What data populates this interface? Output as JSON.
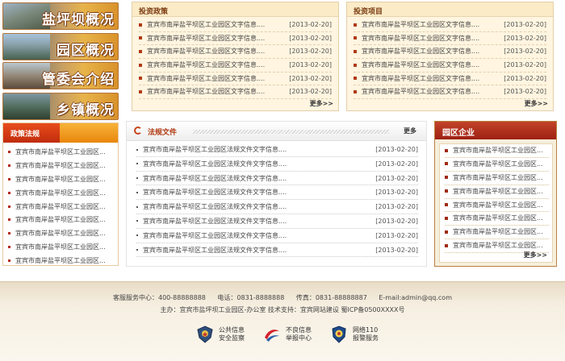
{
  "left_nav": [
    {
      "title": "盐坪坝概况"
    },
    {
      "title": "园区概况"
    },
    {
      "title": "管委会介绍"
    },
    {
      "title": "乡镇概况"
    }
  ],
  "policy_section": {
    "title": "政策法规",
    "items": [
      "宜宾市南岸盐平坝区工业园区...",
      "宜宾市南岸盐平坝区工业园区...",
      "宜宾市南岸盐平坝区工业园区...",
      "宜宾市南岸盐平坝区工业园区...",
      "宜宾市南岸盐平坝区工业园区...",
      "宜宾市南岸盐平坝区工业园区...",
      "宜宾市南岸盐平坝区工业园区...",
      "宜宾市南岸盐平坝区工业园区...",
      "宜宾市南岸盐平坝区工业园区..."
    ]
  },
  "investment_policy": {
    "title": "投资政策",
    "more": "更多>>",
    "items": [
      {
        "title": "宜宾市南岸盐平坝区工业园区文字信息....",
        "date": "[2013-02-20]"
      },
      {
        "title": "宜宾市南岸盐平坝区工业园区文字信息....",
        "date": "[2013-02-20]"
      },
      {
        "title": "宜宾市南岸盐平坝区工业园区文字信息....",
        "date": "[2013-02-20]"
      },
      {
        "title": "宜宾市南岸盐平坝区工业园区文字信息....",
        "date": "[2013-02-20]"
      },
      {
        "title": "宜宾市南岸盐平坝区工业园区文字信息....",
        "date": "[2013-02-20]"
      },
      {
        "title": "宜宾市南岸盐平坝区工业园区文字信息....",
        "date": "[2013-02-20]"
      }
    ]
  },
  "investment_projects": {
    "title": "投资项目",
    "more": "更多>>",
    "items": [
      {
        "title": "宜宾市南岸盐平坝区工业园区文字信息....",
        "date": "[2013-02-20]"
      },
      {
        "title": "宜宾市南岸盐平坝区工业园区文字信息....",
        "date": "[2013-02-20]"
      },
      {
        "title": "宜宾市南岸盐平坝区工业园区文字信息....",
        "date": "[2013-02-20]"
      },
      {
        "title": "宜宾市南岸盐平坝区工业园区文字信息....",
        "date": "[2013-02-20]"
      },
      {
        "title": "宜宾市南岸盐平坝区工业园区文字信息....",
        "date": "[2013-02-20]"
      },
      {
        "title": "宜宾市南岸盐平坝区工业园区文字信息....",
        "date": "[2013-02-20]"
      }
    ]
  },
  "law_documents": {
    "title": "法规文件",
    "more": "更多",
    "items": [
      {
        "title": "宜宾市南岸盐平坝区工业园区法规文件文字信息....",
        "date": "[2013-02-20]"
      },
      {
        "title": "宜宾市南岸盐平坝区工业园区法规文件文字信息....",
        "date": "[2013-02-20]"
      },
      {
        "title": "宜宾市南岸盐平坝区工业园区法规文件文字信息....",
        "date": "[2013-02-20]"
      },
      {
        "title": "宜宾市南岸盐平坝区工业园区法规文件文字信息....",
        "date": "[2013-02-20]"
      },
      {
        "title": "宜宾市南岸盐平坝区工业园区法规文件文字信息....",
        "date": "[2013-02-20]"
      },
      {
        "title": "宜宾市南岸盐平坝区工业园区法规文件文字信息....",
        "date": "[2013-02-20]"
      },
      {
        "title": "宜宾市南岸盐平坝区工业园区法规文件文字信息....",
        "date": "[2013-02-20]"
      },
      {
        "title": "宜宾市南岸盐平坝区工业园区法规文件文字信息....",
        "date": "[2013-02-20]"
      }
    ]
  },
  "park_enterprises": {
    "title": "园区企业",
    "more": "更多>>",
    "items": [
      "宜宾市南岸盐平坝区工业园区...",
      "宜宾市南岸盐平坝区工业园区...",
      "宜宾市南岸盐平坝区工业园区...",
      "宜宾市南岸盐平坝区工业园区...",
      "宜宾市南岸盐平坝区工业园区...",
      "宜宾市南岸盐平坝区工业园区...",
      "宜宾市南岸盐平坝区工业园区...",
      "宜宾市南岸盐平坝区工业园区..."
    ]
  },
  "footer": {
    "service": "客服服务中心：400-88888888",
    "phone": "电话：0831-8888888",
    "fax": "传真：0831-88888887",
    "email": "E-mail:admin@qq.com",
    "sponsor": "主办：宜宾市盐坪坝工业园区-办公室 技术支持：宜宾网站建设 蜀ICP备0500XXXX号",
    "badges": [
      {
        "icon": "police-shield-icon",
        "line1": "公共信息",
        "line2": "安全监察"
      },
      {
        "icon": "report-swoosh-icon",
        "line1": "不良信息",
        "line2": "举报中心"
      },
      {
        "icon": "cyber-police-icon",
        "line1": "网络110",
        "line2": "报警服务"
      }
    ]
  },
  "colors": {
    "accent_red": "#b03a12",
    "orange_header": "#e9860c",
    "beige_bg": "#fff5e0",
    "enterprise_red": "#9e2012"
  }
}
